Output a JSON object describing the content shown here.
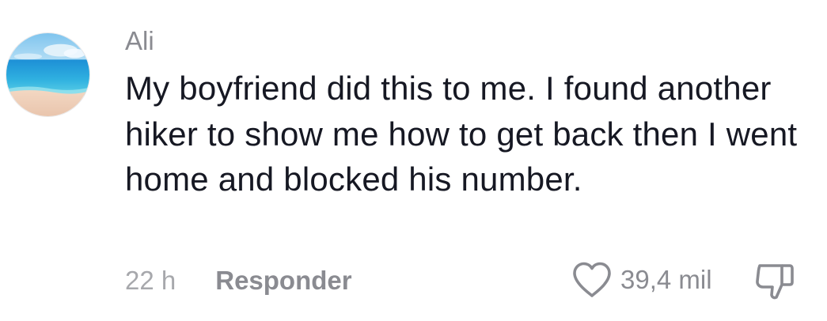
{
  "comment": {
    "username": "Ali",
    "text": "My boyfriend did this to me. I found another hiker to show me how to get back then I went home and blocked his number.",
    "timestamp": "22 h",
    "reply_label": "Responder",
    "like_count": "39,4 mil",
    "icons": {
      "avatar": "beach-avatar",
      "like": "heart-outline-icon",
      "dislike": "thumbs-down-outline-icon"
    }
  },
  "colors": {
    "text_primary": "#161823",
    "text_secondary": "#8a8b91",
    "timestamp": "#a7a8ac",
    "background": "#ffffff"
  }
}
